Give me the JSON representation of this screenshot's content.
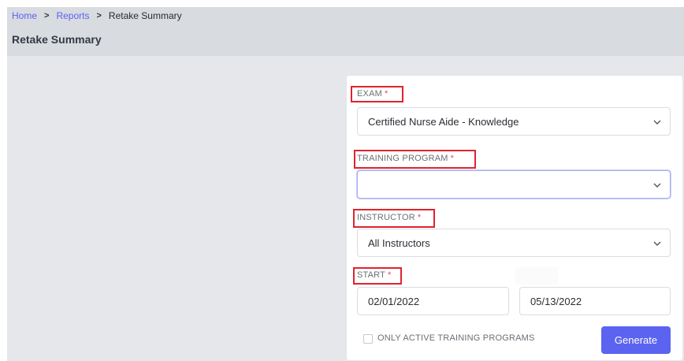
{
  "breadcrumb": {
    "items": [
      {
        "label": "Home"
      },
      {
        "label": "Reports"
      },
      {
        "label": "Retake Summary"
      }
    ],
    "separator": ">"
  },
  "page_title": "Retake Summary",
  "form": {
    "exam": {
      "label": "EXAM",
      "required_mark": "*",
      "value": "Certified Nurse Aide - Knowledge"
    },
    "training_program": {
      "label": "TRAINING PROGRAM",
      "required_mark": "*",
      "value": ""
    },
    "instructor": {
      "label": "INSTRUCTOR",
      "required_mark": "*",
      "value": "All Instructors"
    },
    "start": {
      "label": "START",
      "required_mark": "*",
      "start_date": "02/01/2022",
      "end_date": "05/13/2022"
    },
    "only_active": {
      "label": "ONLY ACTIVE TRAINING PROGRAMS",
      "checked": false
    },
    "generate_label": "Generate"
  },
  "icons": {
    "dropdown": "chevron-down-icon"
  },
  "colors": {
    "accent": "#5b63f0",
    "required": "#e0485a",
    "highlight_box": "#e0232f"
  }
}
